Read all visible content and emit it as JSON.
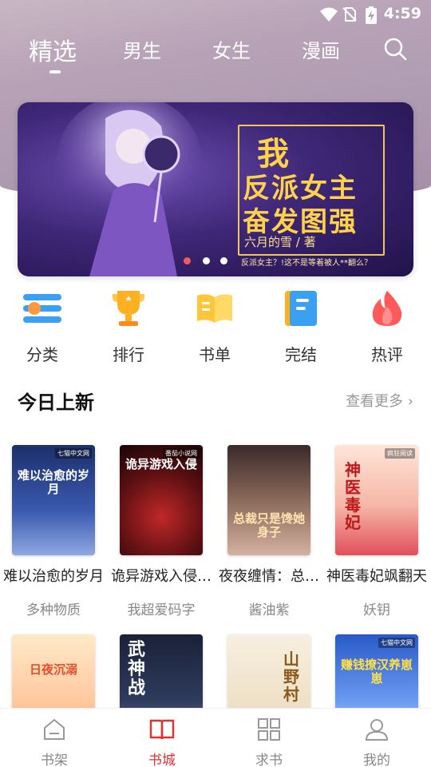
{
  "status_bar": {
    "time": "4:59"
  },
  "tabs": [
    {
      "label": "精选",
      "active": true
    },
    {
      "label": "男生",
      "active": false
    },
    {
      "label": "女生",
      "active": false
    },
    {
      "label": "漫画",
      "active": false
    }
  ],
  "banner": {
    "title_line1": "我",
    "title_line2": "反派女主",
    "title_line3": "奋发图强",
    "author": "六月的雪 / 著",
    "tagline": "反派女主？!这不是等着被人**翻么？",
    "slide_count": 3,
    "active_slide": 1
  },
  "quick_links": [
    {
      "label": "分类",
      "icon": "category-icon"
    },
    {
      "label": "排行",
      "icon": "trophy-icon"
    },
    {
      "label": "书单",
      "icon": "booklist-icon"
    },
    {
      "label": "完结",
      "icon": "finished-book-icon"
    },
    {
      "label": "热评",
      "icon": "flame-icon"
    }
  ],
  "section": {
    "title": "今日上新",
    "see_more": "查看更多"
  },
  "books_row1": [
    {
      "title": "难以治愈的岁月",
      "author": "多种物质",
      "cover_text": "难以治愈的岁月",
      "badge": "七猫中文网"
    },
    {
      "title": "诡异游戏入侵…",
      "author": "我超爱码字",
      "cover_text": "诡异游戏入侵",
      "badge": "番茄小说网"
    },
    {
      "title": "夜夜缠情：总…",
      "author": "酱油紫",
      "cover_text": "总裁只是馋她身子",
      "badge": ""
    },
    {
      "title": "神医毒妃飒翻天",
      "author": "妖钥",
      "cover_text": "神医毒妃",
      "badge": "疯狂阅读"
    }
  ],
  "books_row2": [
    {
      "cover_text": "日夜沉溺",
      "badge": ""
    },
    {
      "cover_text": "武神战",
      "badge": ""
    },
    {
      "cover_text": "山野村",
      "badge": ""
    },
    {
      "cover_text": "赚钱撩汉养崽崽",
      "badge": "七猫中文网"
    }
  ],
  "bottom_nav": [
    {
      "label": "书架",
      "icon": "bookshelf-icon",
      "active": false
    },
    {
      "label": "书城",
      "icon": "bookstore-icon",
      "active": true
    },
    {
      "label": "求书",
      "icon": "request-book-icon",
      "active": false
    },
    {
      "label": "我的",
      "icon": "profile-icon",
      "active": false
    }
  ],
  "colors": {
    "accent": "#e03232",
    "banner_gold": "#ffd24a"
  }
}
